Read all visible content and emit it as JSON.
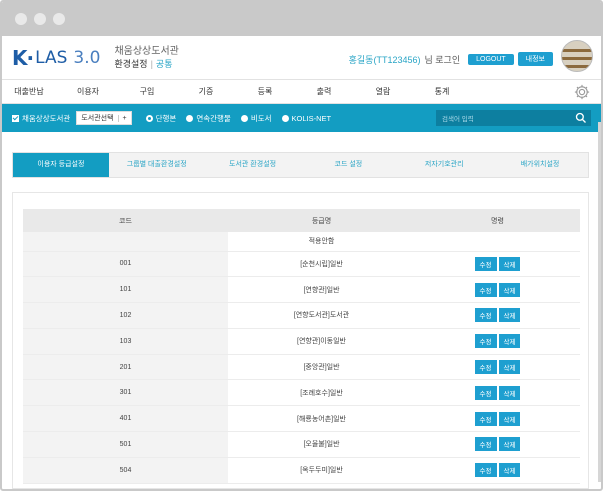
{
  "app": {
    "logo_k": "K·",
    "logo_las": "LAS",
    "logo_version": "3.0",
    "library_name": "채움상상도서관",
    "section_title": "환경설정",
    "section_tag": "공통"
  },
  "user": {
    "name": "홍길동(TT123456)",
    "login_text": "님 로그인",
    "logout_label": "LOGOUT",
    "myinfo_label": "내정보"
  },
  "menu": [
    "대출반납",
    "이용자",
    "구입",
    "기증",
    "등록",
    "출력",
    "열람",
    "통계"
  ],
  "searchbar": {
    "library_checkbox_label": "채움상상도서관",
    "library_select_label": "도서관선택",
    "library_select_plus": "+",
    "radios": [
      {
        "label": "단행본",
        "checked": true
      },
      {
        "label": "연속간행물",
        "checked": false
      },
      {
        "label": "비도서",
        "checked": false
      },
      {
        "label": "KOLIS-NET",
        "checked": false
      }
    ],
    "search_placeholder": "검색어 입력"
  },
  "tabs": [
    {
      "label": "이용자 등급설정",
      "active": true
    },
    {
      "label": "그룹별 대출환경설정",
      "active": false
    },
    {
      "label": "도서관 환경설정",
      "active": false
    },
    {
      "label": "코드 설정",
      "active": false
    },
    {
      "label": "저자기호관리",
      "active": false
    },
    {
      "label": "배가위치설정",
      "active": false
    }
  ],
  "table": {
    "headers": {
      "code": "코드",
      "name": "등급명",
      "action": "명령"
    },
    "group_label": "적용안함",
    "edit_label": "수정",
    "delete_label": "삭제",
    "rows": [
      {
        "code": "001",
        "name": "[순천시립]일반"
      },
      {
        "code": "101",
        "name": "[연향관]일반"
      },
      {
        "code": "102",
        "name": "[연향도서관]도서관"
      },
      {
        "code": "103",
        "name": "[연향관]이동일반"
      },
      {
        "code": "201",
        "name": "[중앙관]일반"
      },
      {
        "code": "301",
        "name": "[조례호수]일반"
      },
      {
        "code": "401",
        "name": "[해룡농어촌]일반"
      },
      {
        "code": "501",
        "name": "[오율불]일반"
      },
      {
        "code": "504",
        "name": "[옥두두미]일반"
      }
    ]
  },
  "colors": {
    "accent": "#139dc2",
    "button": "#1e9fd0",
    "logo": "#1e5da6"
  }
}
